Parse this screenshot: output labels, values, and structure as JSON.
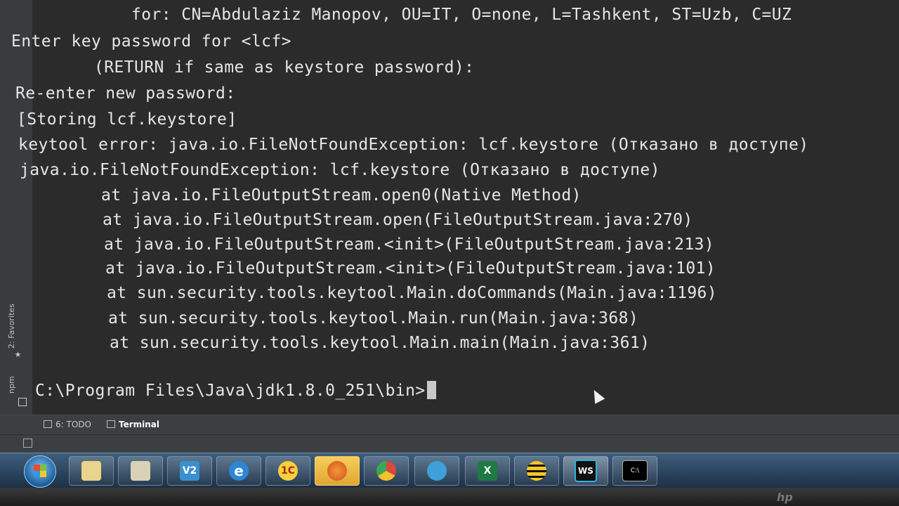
{
  "terminal": {
    "lines": [
      "    for: CN=Abdulaziz Manopov, OU=IT, O=none, L=Tashkent, ST=Uzb, C=UZ",
      "Enter key password for <lcf>",
      "        (RETURN if same as keystore password):",
      "Re-enter new password:",
      "[Storing lcf.keystore]",
      "keytool error: java.io.FileNotFoundException: lcf.keystore (Отказано в доступе)",
      "java.io.FileNotFoundException: lcf.keystore (Отказано в доступе)",
      "        at java.io.FileOutputStream.open0(Native Method)",
      "        at java.io.FileOutputStream.open(FileOutputStream.java:270)",
      "        at java.io.FileOutputStream.<init>(FileOutputStream.java:213)",
      "        at java.io.FileOutputStream.<init>(FileOutputStream.java:101)",
      "        at sun.security.tools.keytool.Main.doCommands(Main.java:1196)",
      "        at sun.security.tools.keytool.Main.run(Main.java:368)",
      "        at sun.security.tools.keytool.Main.main(Main.java:361)"
    ],
    "prompt": "C:\\Program Files\\Java\\jdk1.8.0_251\\bin>"
  },
  "side_tabs": {
    "favorites": "2: Favorites",
    "npm": "npm"
  },
  "tool_tabs": {
    "todo": "6: TODO",
    "terminal": "Terminal"
  },
  "taskbar": {
    "apps": [
      {
        "name": "file-explorer",
        "icon": "folder-icon"
      },
      {
        "name": "media-player",
        "icon": "media-player-icon"
      },
      {
        "name": "virtualbox",
        "icon": "vb-icon",
        "label": "V2"
      },
      {
        "name": "internet-explorer",
        "icon": "ie-icon",
        "label": "e"
      },
      {
        "name": "1c",
        "icon": "1c-icon",
        "label": "1C"
      },
      {
        "name": "firefox",
        "icon": "firefox-icon"
      },
      {
        "name": "chrome",
        "icon": "chrome-icon"
      },
      {
        "name": "telegram",
        "icon": "telegram-icon"
      },
      {
        "name": "excel",
        "icon": "excel-icon",
        "label": "X"
      },
      {
        "name": "beeline",
        "icon": "beeline-icon"
      },
      {
        "name": "webstorm",
        "icon": "webstorm-icon",
        "label": "WS"
      },
      {
        "name": "cmd",
        "icon": "cmd-icon",
        "label": "C:\\"
      }
    ]
  },
  "colors": {
    "terminal_bg": "#2b2b2b",
    "terminal_text": "#e6e6e6",
    "taskbar": "#2a4560"
  }
}
